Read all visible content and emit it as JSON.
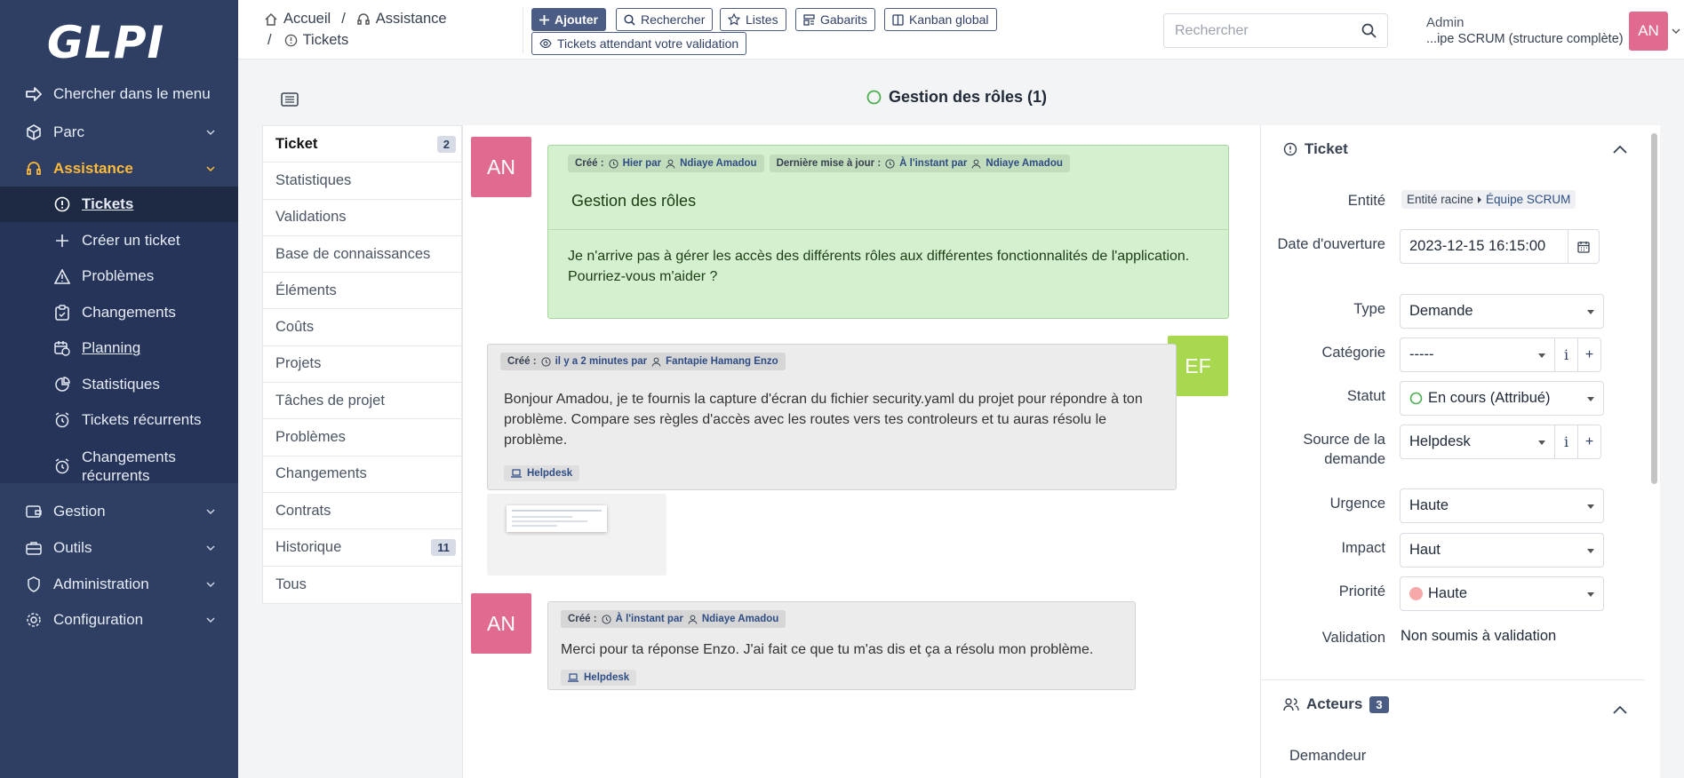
{
  "app": {
    "logo": "GLPI"
  },
  "sidebar": {
    "search_label": "Chercher dans le menu",
    "items": [
      {
        "label": "Parc"
      },
      {
        "label": "Assistance"
      },
      {
        "label": "Tickets"
      },
      {
        "label": "Créer un ticket"
      },
      {
        "label": "Problèmes"
      },
      {
        "label": "Changements"
      },
      {
        "label": "Planning"
      },
      {
        "label": "Statistiques"
      },
      {
        "label": "Tickets récurrents"
      },
      {
        "label": "Changements récurrents"
      },
      {
        "label": "Gestion"
      },
      {
        "label": "Outils"
      },
      {
        "label": "Administration"
      },
      {
        "label": "Configuration"
      }
    ]
  },
  "breadcrumb": {
    "home": "Accueil",
    "sep": "/",
    "section": "Assistance",
    "page": "Tickets"
  },
  "toolbar": {
    "add": "Ajouter",
    "search": "Rechercher",
    "lists": "Listes",
    "templates": "Gabarits",
    "kanban": "Kanban global",
    "pending": "Tickets attendant votre validation"
  },
  "global_search": {
    "placeholder": "Rechercher"
  },
  "user": {
    "name": "Admin",
    "entity": "...ipe SCRUM (structure complète)",
    "initials": "AN"
  },
  "ticket": {
    "title": "Gestion des rôles (1)"
  },
  "tabs": [
    {
      "label": "Ticket",
      "count": "2"
    },
    {
      "label": "Statistiques"
    },
    {
      "label": "Validations"
    },
    {
      "label": "Base de connaissances"
    },
    {
      "label": "Éléments"
    },
    {
      "label": "Coûts"
    },
    {
      "label": "Projets"
    },
    {
      "label": "Tâches de projet"
    },
    {
      "label": "Problèmes"
    },
    {
      "label": "Changements"
    },
    {
      "label": "Contrats"
    },
    {
      "label": "Historique",
      "count": "11"
    },
    {
      "label": "Tous"
    }
  ],
  "timeline": {
    "entries": [
      {
        "initials": "AN",
        "created_label": "Créé :",
        "created_when": "Hier par",
        "created_by": "Ndiaye Amadou",
        "updated_label": "Dernière mise à jour :",
        "updated_when": "À l'instant par",
        "updated_by": "Ndiaye Amadou",
        "title": "Gestion des rôles",
        "content": "Je n'arrive pas à gérer les accès des différents rôles aux différentes fonctionnalités de l'application. Pourriez-vous m'aider ?"
      },
      {
        "initials": "EF",
        "created_label": "Créé :",
        "created_when": "il y a 2 minutes par",
        "created_by": "Fantapie Hamang Enzo",
        "content": "Bonjour Amadou, je te fournis la capture d'écran du fichier security.yaml du projet pour répondre à ton problème. Compare ses règles d'accès avec les routes vers tes controleurs et tu auras résolu le problème.",
        "source": "Helpdesk"
      },
      {
        "initials": "AN",
        "created_label": "Créé :",
        "created_when": "À l'instant par",
        "created_by": "Ndiaye Amadou",
        "content": "Merci pour ta réponse Enzo. J'ai fait ce que tu m'as dis et ça a résolu mon problème.",
        "source": "Helpdesk"
      }
    ]
  },
  "panel": {
    "ticket_header": "Ticket",
    "fields": {
      "entity_label": "Entité",
      "entity_root": "Entité racine",
      "entity_child": "Équipe SCRUM",
      "opening_label": "Date d'ouverture",
      "opening_value": "2023-12-15 16:15:00",
      "type_label": "Type",
      "type_value": "Demande",
      "category_label": "Catégorie",
      "category_value": "-----",
      "status_label": "Statut",
      "status_value": "En cours (Attribué)",
      "source_label": "Source de la demande",
      "source_value": "Helpdesk",
      "urgency_label": "Urgence",
      "urgency_value": "Haute",
      "impact_label": "Impact",
      "impact_value": "Haut",
      "priority_label": "Priorité",
      "priority_value": "Haute",
      "validation_label": "Validation",
      "validation_value": "Non soumis à validation"
    },
    "actors_header": "Acteurs",
    "actors_count": "3",
    "requester_label": "Demandeur"
  },
  "colors": {
    "sidebar_bg": "#2f3f64",
    "accent": "#fdba3a",
    "avatar_an": "#e06b8f",
    "avatar_ef": "#a7d84e",
    "followup_green": "#d5f0cf",
    "status_ok": "#4caf50",
    "priority_high": "#f7a8a8"
  }
}
